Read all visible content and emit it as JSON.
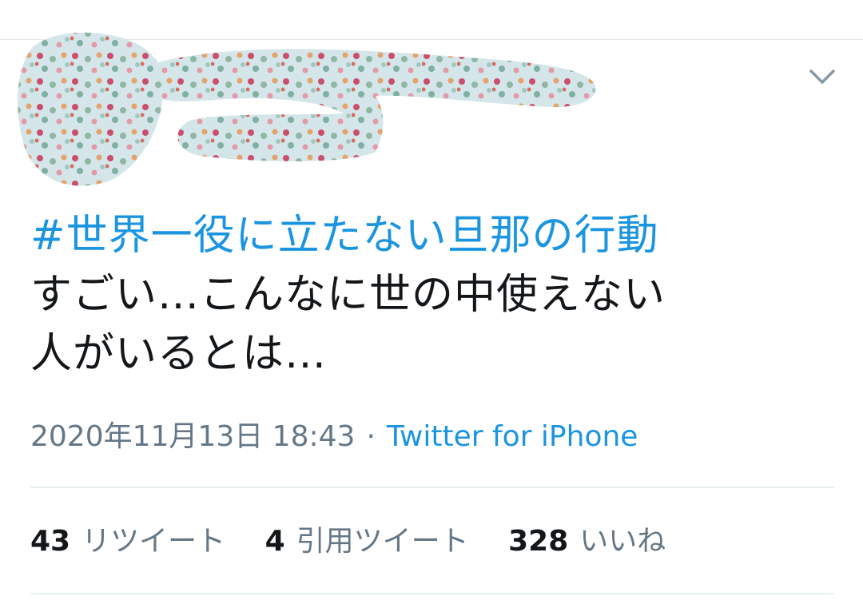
{
  "tweet": {
    "hashtag": "#世界一役に立たない旦那の行動",
    "text_line1": "すごい…こんなに世の中使えない",
    "text_line2": "人がいるとは…",
    "timestamp": "2020年11月13日 18:43",
    "separator": "·",
    "source": "Twitter for iPhone"
  },
  "stats": {
    "retweets_count": "43",
    "retweets_label": "リツイート",
    "quotes_count": "4",
    "quotes_label": "引用ツイート",
    "likes_count": "328",
    "likes_label": "いいね"
  },
  "icons": {
    "menu": "chevron-down-icon",
    "redaction": "redaction-scribble"
  },
  "colors": {
    "link": "#1b95e0",
    "text": "#14171a",
    "secondary": "#657786",
    "divider": "#e6ecf0",
    "redaction_fill": "#d5e6ea"
  }
}
